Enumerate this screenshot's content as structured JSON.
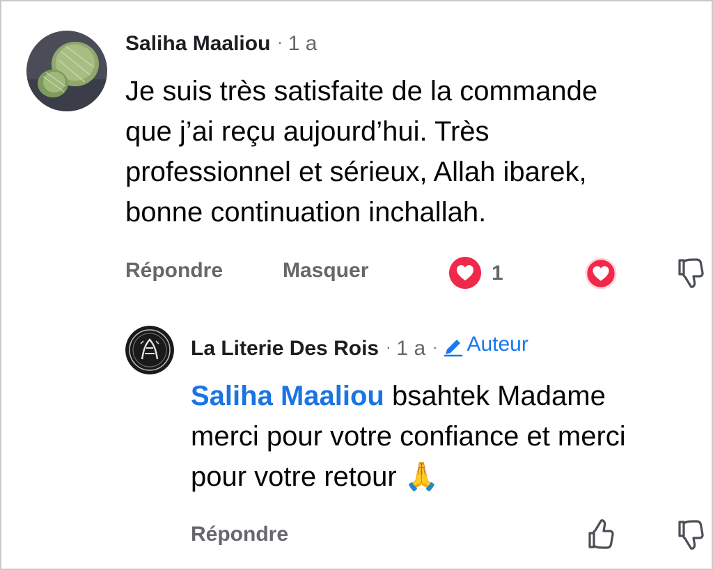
{
  "comment": {
    "author": "Saliha Maaliou",
    "time": "1 a",
    "text_lines": [
      "Je suis très satisfaite de la commande",
      "que j’ai reçu aujourd’hui. Très",
      "professionnel et sérieux, Allah ibarek,",
      "bonne continuation inchallah."
    ],
    "actions": {
      "reply": "Répondre",
      "hide": "Masquer"
    },
    "reaction_count": "1"
  },
  "reply": {
    "author": "La Literie Des Rois",
    "time": "1 a",
    "badge_label": "Auteur",
    "mention": "Saliha Maaliou",
    "text_lines": [
      " bsahtek Madame",
      "merci pour votre confiance et merci",
      "pour votre retour 🙏"
    ],
    "actions": {
      "reply": "Répondre"
    }
  },
  "colors": {
    "text": "#050505",
    "muted": "#65676b",
    "link_blue": "#1b74e4",
    "love_red": "#f0284a"
  },
  "icons": {
    "love_reaction": "heart-reaction-icon",
    "love_button": "heart-outline-icon",
    "dislike": "thumbs-down-icon",
    "like": "thumbs-up-icon",
    "author_badge": "pencil-icon"
  }
}
